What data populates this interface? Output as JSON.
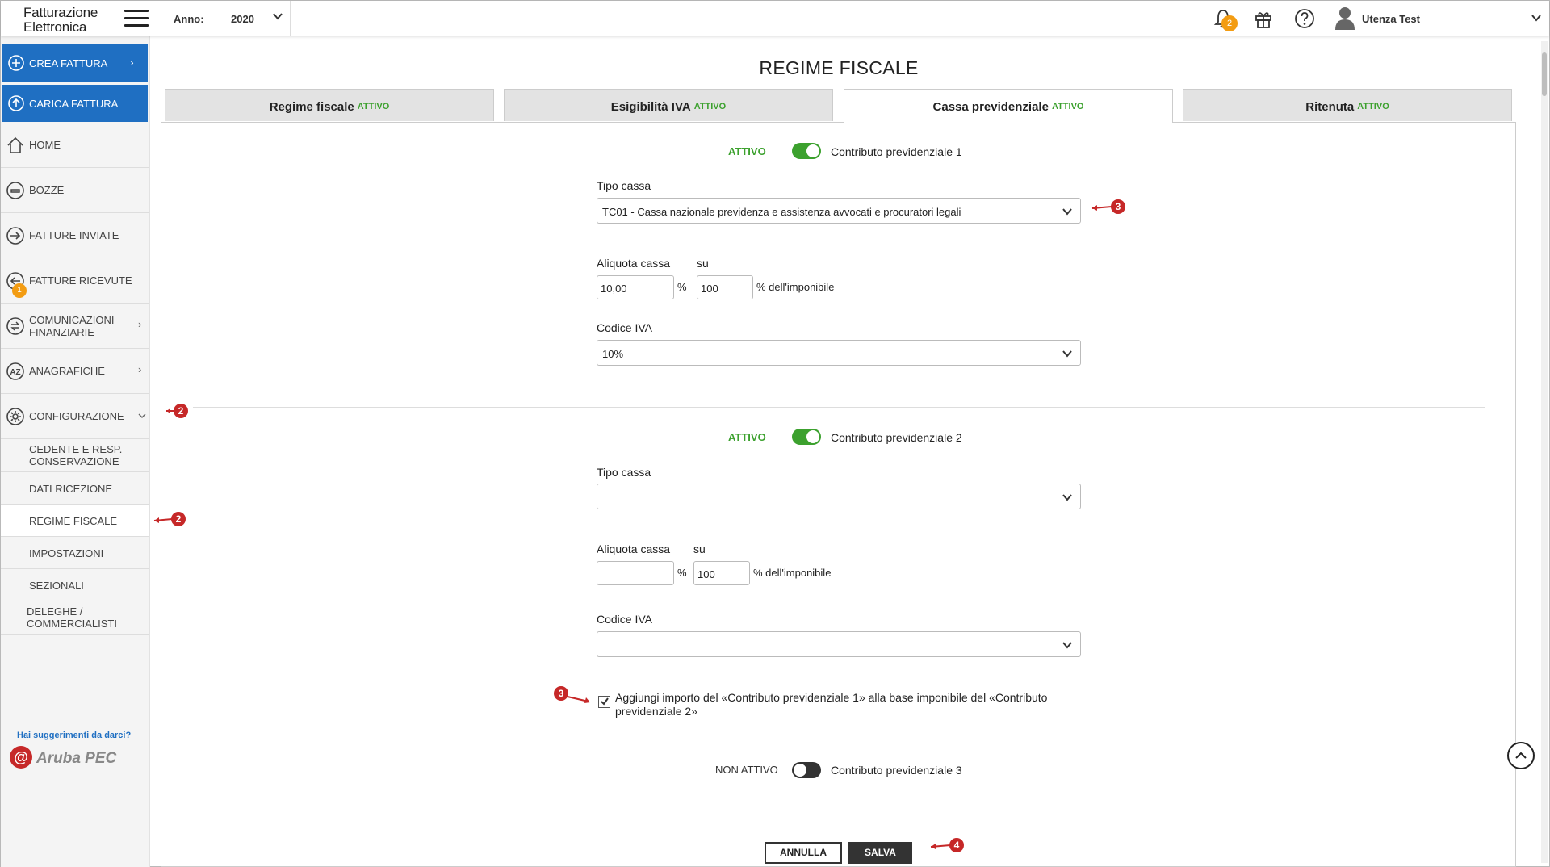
{
  "app": {
    "logo_line1": "Fatturazione",
    "logo_line2": "Elettronica"
  },
  "header": {
    "anno_label": "Anno:",
    "anno_value": "2020",
    "notifications_count": "2",
    "user_name": "Utenza Test"
  },
  "sidebar": {
    "crea_fattura": "CREA FATTURA",
    "carica_fattura": "CARICA FATTURA",
    "items": [
      {
        "label": "HOME",
        "icon": "home-icon"
      },
      {
        "label": "BOZZE",
        "icon": "drafts-icon"
      },
      {
        "label": "FATTURE INVIATE",
        "icon": "sent-icon"
      },
      {
        "label": "FATTURE RICEVUTE",
        "icon": "received-icon",
        "badge": "1"
      },
      {
        "label1": "COMUNICAZIONI",
        "label2": "FINANZIARIE",
        "icon": "communications-icon"
      },
      {
        "label": "ANAGRAFICHE",
        "icon": "az-icon"
      },
      {
        "label": "CONFIGURAZIONE",
        "icon": "gear-icon"
      }
    ],
    "sub_items": [
      {
        "label1": "CEDENTE E RESP.",
        "label2": "CONSERVAZIONE"
      },
      {
        "label": "DATI RICEZIONE"
      },
      {
        "label": "REGIME FISCALE"
      },
      {
        "label": "IMPOSTAZIONI"
      },
      {
        "label": "SEZIONALI"
      },
      {
        "label1": "DELEGHE /",
        "label2": "COMMERCIALISTI"
      }
    ],
    "suggestions_link": "Hai suggerimenti da darci?",
    "brand_logo": "Aruba PEC"
  },
  "page": {
    "title": "REGIME FISCALE",
    "tabs": [
      {
        "label": "Regime fiscale",
        "status": "ATTIVO"
      },
      {
        "label": "Esigibilità IVA",
        "status": "ATTIVO"
      },
      {
        "label": "Cassa previdenziale",
        "status": "ATTIVO",
        "active": true
      },
      {
        "label": "Ritenuta",
        "status": "ATTIVO"
      }
    ]
  },
  "contributi": [
    {
      "status": "ATTIVO",
      "name": "Contributo previdenziale 1",
      "tipo_cassa_label": "Tipo cassa",
      "tipo_cassa_value": "TC01 - Cassa nazionale previdenza e assistenza avvocati e procuratori legali",
      "aliquota_label": "Aliquota cassa",
      "su_label": "su",
      "aliquota_value": "10,00",
      "pct_symbol": "%",
      "su_value": "100",
      "imponibile_label": "% dell'imponibile",
      "codice_iva_label": "Codice IVA",
      "codice_iva_value": "10%"
    },
    {
      "status": "ATTIVO",
      "name": "Contributo previdenziale 2",
      "tipo_cassa_label": "Tipo cassa",
      "tipo_cassa_value": "",
      "aliquota_label": "Aliquota cassa",
      "su_label": "su",
      "aliquota_value": "",
      "pct_symbol": "%",
      "su_value": "100",
      "imponibile_label": "% dell'imponibile",
      "codice_iva_label": "Codice IVA",
      "codice_iva_value": ""
    },
    {
      "status": "NON ATTIVO",
      "name": "Contributo previdenziale 3"
    }
  ],
  "checkbox": {
    "line1": "Aggiungi importo del «Contributo previdenziale 1» alla base imponibile del «Contributo",
    "line2": "previdenziale 2»",
    "checked": true
  },
  "actions": {
    "annulla": "ANNULLA",
    "salva": "SALVA"
  },
  "annotations": [
    "2",
    "2",
    "3",
    "3",
    "4"
  ],
  "colors": {
    "primary_blue": "#1f6fc2",
    "active_green": "#3ca12e",
    "badge_orange": "#f39c12",
    "annotation_red": "#c62828"
  }
}
